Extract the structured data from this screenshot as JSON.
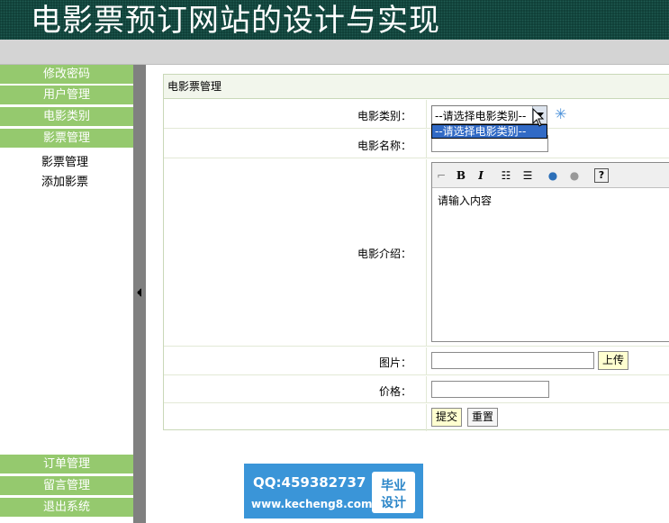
{
  "header": {
    "title": "电影票预订网站的设计与实现"
  },
  "sidebar": {
    "top_items": [
      {
        "label": "修改密码"
      },
      {
        "label": "用户管理"
      },
      {
        "label": "电影类别"
      },
      {
        "label": "影票管理"
      }
    ],
    "sub_items": [
      {
        "label": "影票管理"
      },
      {
        "label": "添加影票"
      }
    ],
    "bottom_items": [
      {
        "label": "订单管理"
      },
      {
        "label": "留言管理"
      },
      {
        "label": "退出系统"
      }
    ]
  },
  "panel": {
    "title": "电影票管理",
    "category": {
      "label": "电影类别：",
      "selected": "--请选择电影类别--",
      "options": [
        "--请选择电影类别--"
      ]
    },
    "name": {
      "label": "电影名称：",
      "value": ""
    },
    "intro": {
      "label": "电影介绍：",
      "content": "请输入内容",
      "toolbar": {
        "bold": "B",
        "italic": "I",
        "help": "?"
      }
    },
    "image": {
      "label": "图片：",
      "value": "",
      "upload_label": "上传"
    },
    "price": {
      "label": "价格：",
      "value": ""
    },
    "actions": {
      "submit_label": "提交",
      "reset_label": "重置"
    }
  },
  "watermark": {
    "qq": "QQ:459382737",
    "site": "www.kecheng8.com",
    "badge_line1": "毕业",
    "badge_line2": "设计"
  },
  "colors": {
    "header_bg": "#0d3b33",
    "nav_green": "#95c96e",
    "select_highlight": "#316ac5",
    "watermark_blue": "#3a95d8"
  }
}
